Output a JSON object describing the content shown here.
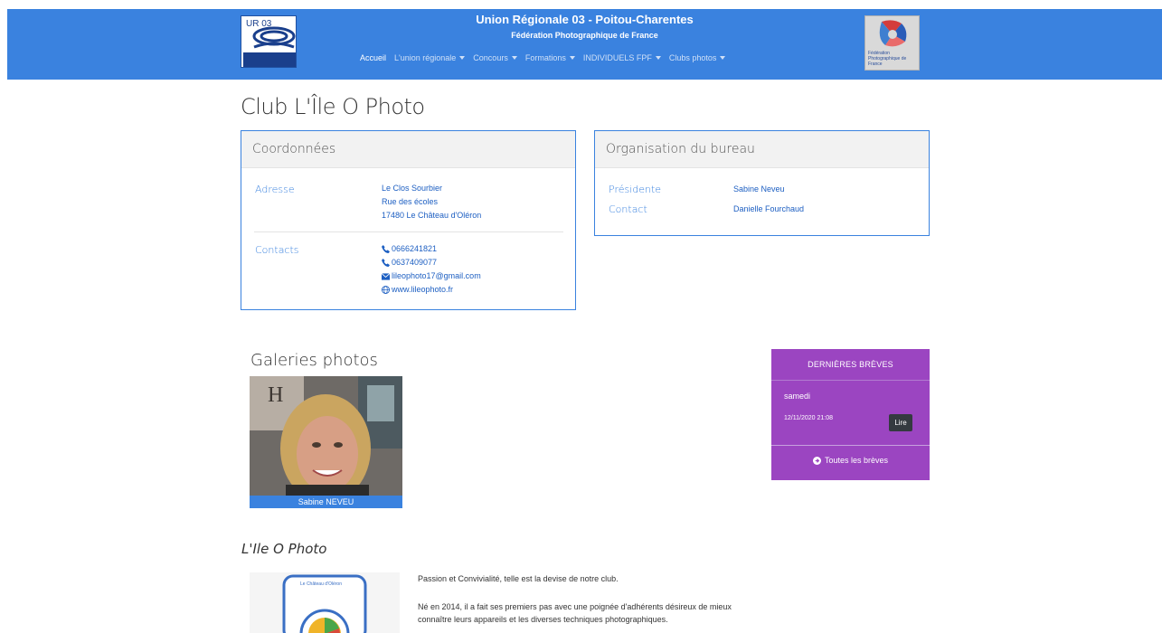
{
  "header": {
    "title": "Union Régionale 03 - Poitou-Charentes",
    "subtitle": "Fédération Photographique de France",
    "logo_left_text": "UR 03",
    "logo_right_text": "Fédération Photographique de France",
    "nav": [
      {
        "label": "Accueil",
        "active": true,
        "dropdown": false
      },
      {
        "label": "L'union régionale",
        "active": false,
        "dropdown": true
      },
      {
        "label": "Concours",
        "active": false,
        "dropdown": true
      },
      {
        "label": "Formations",
        "active": false,
        "dropdown": true
      },
      {
        "label": "INDIVIDUELS FPF",
        "active": false,
        "dropdown": true
      },
      {
        "label": "Clubs photos",
        "active": false,
        "dropdown": true
      }
    ]
  },
  "page": {
    "title": "Club L'Île O Photo"
  },
  "coordonnees": {
    "header": "Coordonnées",
    "address_label": "Adresse",
    "address_lines": [
      "Le Clos Sourbier",
      "Rue des écoles",
      "17480 Le Château d'Oléron"
    ],
    "contacts_label": "Contacts",
    "phone1": "0666241821",
    "phone2": "0637409077",
    "email": "lileophoto17@gmail.com",
    "website": "www.lileophoto.fr"
  },
  "organisation": {
    "header": "Organisation du bureau",
    "rows": [
      {
        "role": "Présidente",
        "name": "Sabine Neveu"
      },
      {
        "role": "Contact",
        "name": "Danielle Fourchaud"
      }
    ]
  },
  "galeries": {
    "title": "Galeries photos",
    "items": [
      {
        "caption": "Sabine NEVEU"
      }
    ]
  },
  "breves": {
    "header": "DERNIÈRES BRÈVES",
    "items": [
      {
        "title": "samedi",
        "date": "12/11/2020 21:08",
        "button": "Lire"
      }
    ],
    "all_link": "Toutes les brèves"
  },
  "club": {
    "name": "L'Ile O Photo",
    "logo_text": "Le Château d'Oléron",
    "paragraphs": [
      "Passion et Convivialité, telle est la devise de notre club.",
      "Né en 2014, il a fait ses premiers pas avec une poignée d'adhérents désireux de mieux connaître leurs appareils et les diverses techniques photographiques."
    ]
  },
  "colors": {
    "brand_blue": "#3a82df",
    "breves_purple": "#9b45c1",
    "link_blue": "#1d5fc2"
  }
}
